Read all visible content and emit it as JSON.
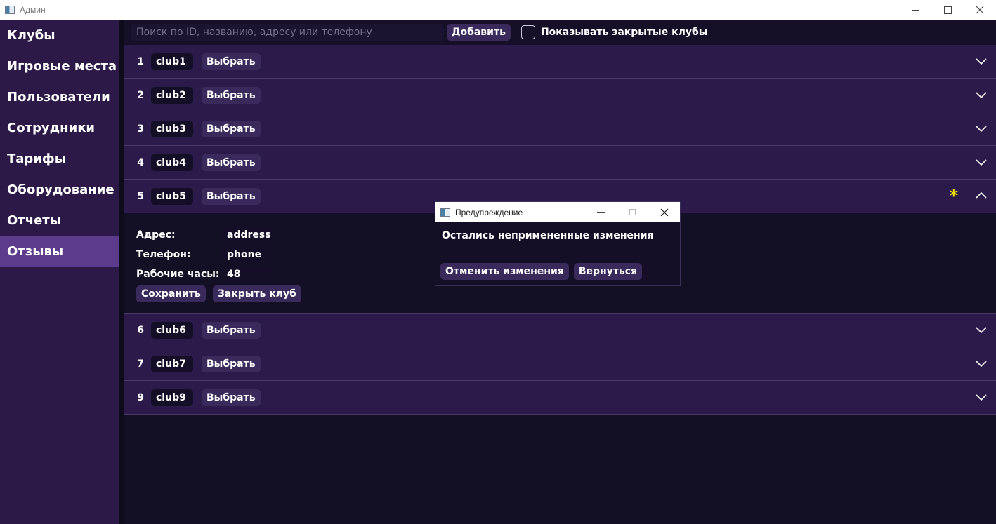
{
  "window": {
    "title": "Админ"
  },
  "sidebar": {
    "items": [
      {
        "label": "Клубы"
      },
      {
        "label": "Игровые места"
      },
      {
        "label": "Пользователи"
      },
      {
        "label": "Сотрудники"
      },
      {
        "label": "Тарифы"
      },
      {
        "label": "Оборудование"
      },
      {
        "label": "Отчеты"
      },
      {
        "label": "Отзывы"
      }
    ],
    "active_index": 7
  },
  "toolbar": {
    "search_placeholder": "Поиск по ID, названию, адресу или телефону",
    "add_label": "Добавить",
    "show_closed_label": "Показывать закрытые клубы",
    "show_closed_checked": false
  },
  "clubs": [
    {
      "id": "1",
      "name": "club1",
      "select_label": "Выбрать"
    },
    {
      "id": "2",
      "name": "club2",
      "select_label": "Выбрать"
    },
    {
      "id": "3",
      "name": "club3",
      "select_label": "Выбрать"
    },
    {
      "id": "4",
      "name": "club4",
      "select_label": "Выбрать"
    },
    {
      "id": "5",
      "name": "club5",
      "select_label": "Выбрать",
      "unsaved_marker": "*"
    },
    {
      "id": "6",
      "name": "club6",
      "select_label": "Выбрать"
    },
    {
      "id": "7",
      "name": "club7",
      "select_label": "Выбрать"
    },
    {
      "id": "9",
      "name": "club9",
      "select_label": "Выбрать"
    }
  ],
  "expanded_club": {
    "address_label": "Адрес:",
    "address_value": "address",
    "phone_label": "Телефон:",
    "phone_value": "phone",
    "hours_label": "Рабочие часы:",
    "hours_value": "48",
    "save_label": "Сохранить",
    "close_label": "Закрыть клуб"
  },
  "dialog": {
    "title": "Предупреждение",
    "message": "Остались непримененные изменения",
    "cancel_label": "Отменить изменения",
    "back_label": "Вернуться"
  },
  "colors": {
    "sidebar_bg": "#2c1947",
    "sidebar_active": "#5c3a8c",
    "row_bg": "#2c1a4a",
    "main_bg": "#130f24",
    "button_bg": "#3a2a5c",
    "unsaved_star": "#f5e400"
  }
}
